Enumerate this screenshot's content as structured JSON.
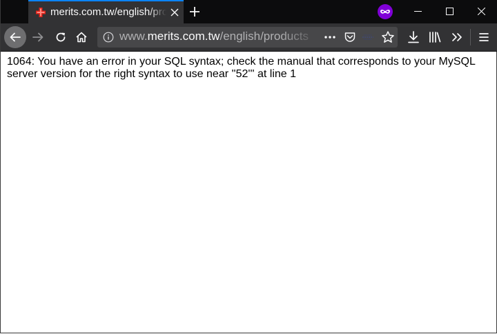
{
  "browser": {
    "tab": {
      "title": "merits.com.tw/english/products"
    },
    "urlbar": {
      "prefix": "www.",
      "host": "merits.com.tw",
      "path": "/english/products"
    }
  },
  "page": {
    "error_message": "1064: You have an error in your SQL syntax; check the manual that corresponds to your MySQL server version for the right syntax to use near ''52''' at line 1"
  },
  "colors": {
    "tabstrip_bg": "#0c0c0d",
    "toolbar_bg": "#323234",
    "urlbar_bg": "#474749",
    "private_accent": "#8000d7",
    "favicon_red": "#e2231a"
  },
  "icons": {
    "favicon": "red-cross-icon",
    "private": "private-browsing-mask-icon"
  }
}
